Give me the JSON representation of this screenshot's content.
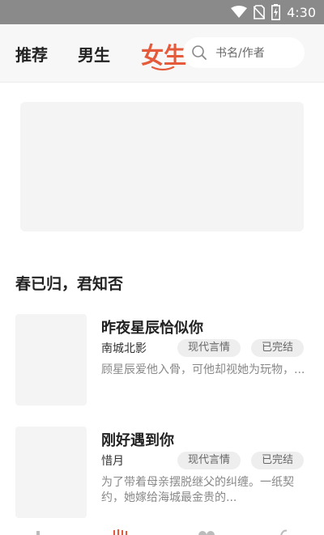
{
  "status_bar": {
    "time": "4:30",
    "icons": [
      "wifi-icon",
      "no-sim-icon",
      "battery-charging-icon"
    ]
  },
  "topnav": {
    "tabs": [
      {
        "label": "推荐",
        "active": false
      },
      {
        "label": "男生",
        "active": false
      },
      {
        "label": "女生",
        "active": true
      }
    ],
    "active_color": "#e45a3a",
    "search": {
      "placeholder": "书名/作者",
      "icon": "search-icon"
    }
  },
  "section": {
    "title": "春已归，君知否"
  },
  "books": [
    {
      "title": "昨夜星辰恰似你",
      "author": "南城北影",
      "genre": "现代言情",
      "status": "已完结",
      "description": "顾星辰爱他入骨，可他却视她为玩物，..."
    },
    {
      "title": "刚好遇到你",
      "author": "惜月",
      "genre": "现代言情",
      "status": "已完结",
      "description": "为了带着母亲摆脱继父的纠缠。一纸契约，她嫁给海城最金贵的..."
    }
  ],
  "bottom_nav": {
    "icons": [
      "home-icon",
      "bookstore-icon",
      "category-icon",
      "profile-icon"
    ]
  }
}
